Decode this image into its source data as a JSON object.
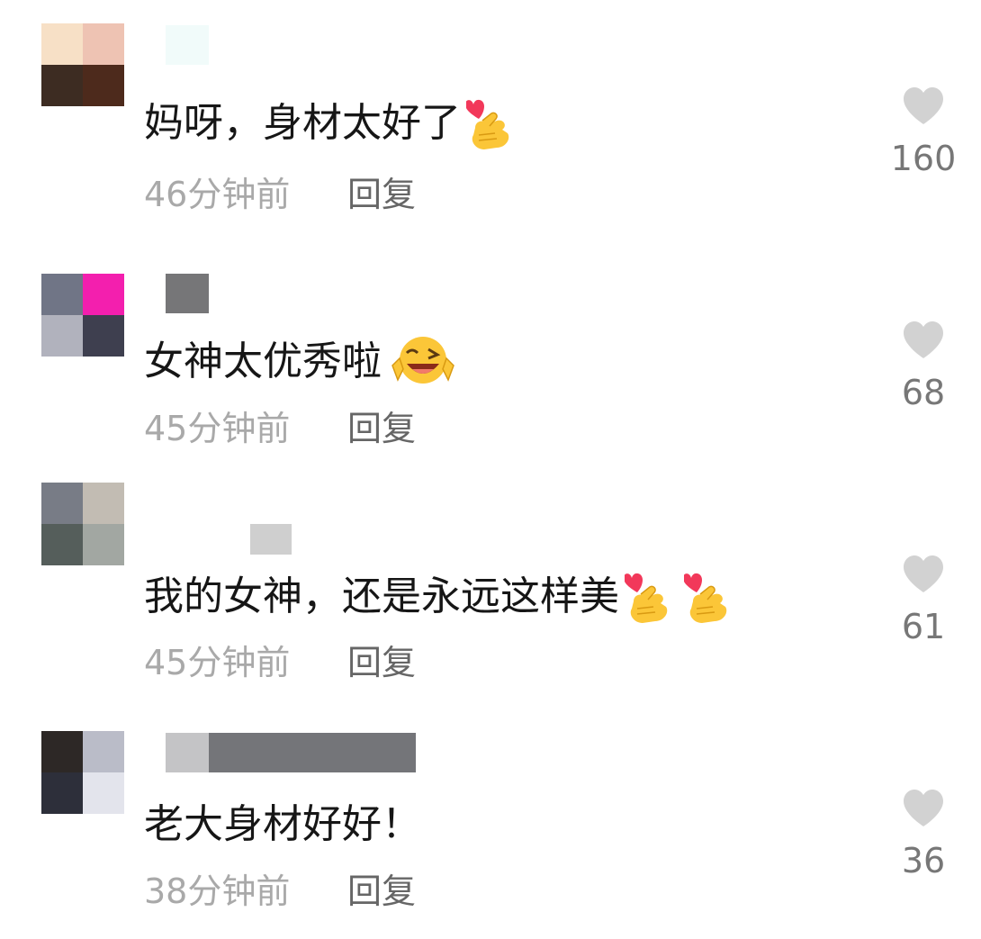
{
  "comments": [
    {
      "text": "妈呀，身材太好了",
      "emoji_icons": [
        "finger-heart-icon"
      ],
      "time": "46分钟前",
      "reply_label": "回复",
      "likes": "160",
      "avatar_colors": [
        "#f7e0c6",
        "#eec3b3",
        "#3d2c22",
        "#4d2a1c"
      ]
    },
    {
      "text": "女神太优秀啦",
      "emoji_icons": [
        "winking-laughing-face-icon"
      ],
      "time": "45分钟前",
      "reply_label": "回复",
      "likes": "68",
      "avatar_colors": [
        "#707586",
        "#f31fae",
        "#b1b2bd",
        "#3e3f4f"
      ]
    },
    {
      "text": "我的女神，还是永远这样美",
      "emoji_icons": [
        "finger-heart-icon",
        "finger-heart-icon"
      ],
      "time": "45分钟前",
      "reply_label": "回复",
      "likes": "61",
      "avatar_colors": [
        "#787c86",
        "#c2bcb3",
        "#555e5b",
        "#a2a7a2"
      ]
    },
    {
      "text": "老大身材好好！",
      "emoji_icons": [],
      "time": "38分钟前",
      "reply_label": "回复",
      "likes": "36",
      "avatar_colors": [
        "#2d2826",
        "#babcc8",
        "#2d2f3a",
        "#e3e4ec"
      ]
    }
  ],
  "colors": {
    "text": "#161616",
    "meta": "#a9a9a9",
    "reply": "#666666",
    "like_heart": "#d2d2d2",
    "like_count": "#777777"
  }
}
